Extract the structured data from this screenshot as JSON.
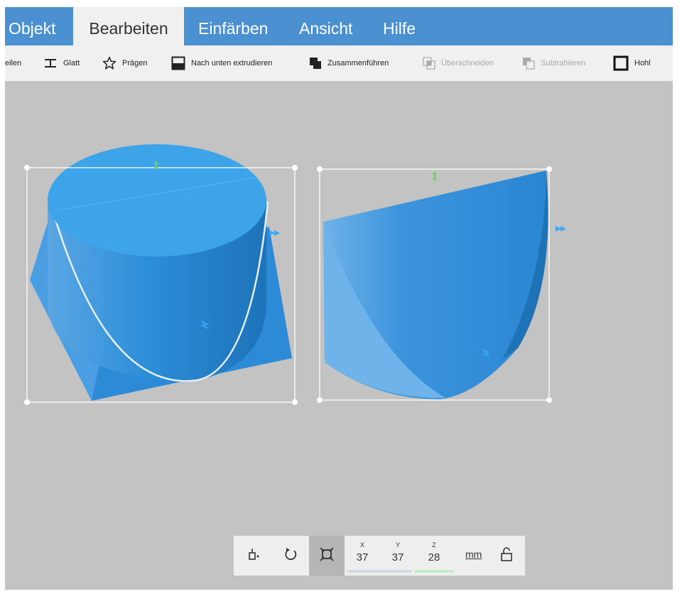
{
  "menubar": {
    "tabs": [
      {
        "label": "Objekt",
        "active": false
      },
      {
        "label": "Bearbeiten",
        "active": true
      },
      {
        "label": "Einfärben",
        "active": false
      },
      {
        "label": "Ansicht",
        "active": false
      },
      {
        "label": "Hilfe",
        "active": false
      }
    ]
  },
  "toolbar": {
    "items": [
      {
        "label": "eilen",
        "icon": "none",
        "enabled": true
      },
      {
        "label": "Glatt",
        "icon": "smooth-icon",
        "enabled": true
      },
      {
        "label": "Prägen",
        "icon": "star-icon",
        "enabled": true
      },
      {
        "label": "Nach unten extrudieren",
        "icon": "extrude-down-icon",
        "enabled": true
      },
      {
        "label": "Zusammenführen",
        "icon": "merge-icon",
        "enabled": true
      },
      {
        "label": "Überschneiden",
        "icon": "intersect-icon",
        "enabled": false
      },
      {
        "label": "Subtrahieren",
        "icon": "subtract-icon",
        "enabled": false
      },
      {
        "label": "Hohl",
        "icon": "hollow-icon",
        "enabled": true
      }
    ]
  },
  "bottombar": {
    "tools": [
      {
        "icon": "move-to-ground-icon"
      },
      {
        "icon": "rotate-icon"
      },
      {
        "icon": "scale-icon",
        "active": true
      }
    ],
    "dimensions": [
      {
        "axis": "X",
        "value": "37"
      },
      {
        "axis": "Y",
        "value": "37"
      },
      {
        "axis": "Z",
        "value": "28"
      }
    ],
    "unit": "mm",
    "lock_icon": "lock-icon"
  },
  "colors": {
    "menubar": "#4b91d2",
    "toolbar": "#f0f0f0",
    "viewport": "#c3c3c3",
    "object_blue": "#2f8fd8",
    "handle_green": "#6ad06a",
    "handle_blue": "#3aa8f0"
  }
}
